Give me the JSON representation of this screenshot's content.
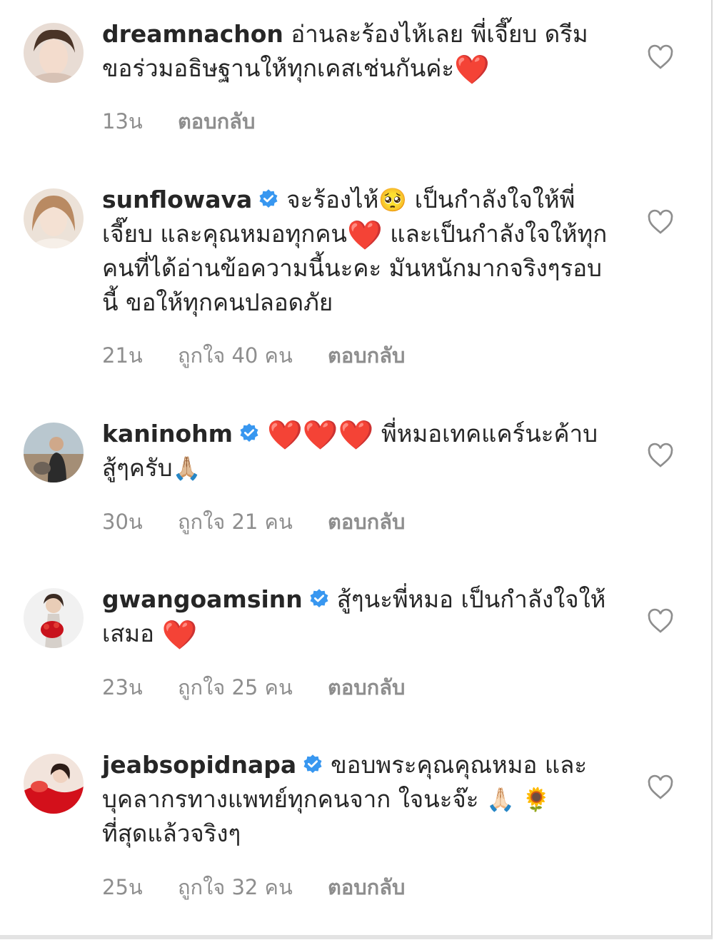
{
  "colors": {
    "text": "#262626",
    "meta": "#8e8e8e",
    "verified": "#3897f0",
    "heart": "#e0101b"
  },
  "icons": {
    "like": "heart-outline-icon",
    "verified": "verified-badge-icon"
  },
  "comments": [
    {
      "username": "dreamnachon",
      "verified": false,
      "text_parts": [
        "อ่านละร้องไห้เลย พี่เจี๊ยบ ดรีมขอร่วมอธิษฐานให้ทุกเคสเช่นกันค่ะ",
        "❤️"
      ],
      "time": "13น",
      "likes": "",
      "reply": "ตอบกลับ"
    },
    {
      "username": "sunflowava",
      "verified": true,
      "text_parts": [
        "จะร้องไห้",
        "🥺",
        " เป็นกำลังใจให้พี่เจี๊ยบ และคุณหมอทุกคน",
        "❤️",
        " และเป็นกำลังใจให้ทุกคนที่ได้อ่านข้อความนี้นะคะ มันหนักมากจริงๆรอบนี้ ขอให้ทุกคนปลอดภัย"
      ],
      "time": "21น",
      "likes": "ถูกใจ 40 คน",
      "reply": "ตอบกลับ"
    },
    {
      "username": "kaninohm",
      "verified": true,
      "text_parts": [
        "❤️❤️❤️",
        " พี่หมอเทคแคร์นะค้าบ สู้ๆครับ",
        "🙏🏼"
      ],
      "time": "30น",
      "likes": "ถูกใจ 21 คน",
      "reply": "ตอบกลับ"
    },
    {
      "username": "gwangoamsinn",
      "verified": true,
      "text_parts": [
        "สู้ๆนะพี่หมอ เป็นกำลังใจให้เสมอ ",
        "❤️"
      ],
      "time": "23น",
      "likes": "ถูกใจ 25 คน",
      "reply": "ตอบกลับ"
    },
    {
      "username": "jeabsopidnapa",
      "verified": true,
      "text_parts": [
        "ขอบพระคุณคุณหมอ และบุคลากรทางแพทย์ทุกคนจาก ใจนะจ๊ะ ",
        "🙏🏻 🌻",
        "ที่สุดแล้วจริงๆ"
      ],
      "time": "25น",
      "likes": "ถูกใจ 32 คน",
      "reply": "ตอบกลับ"
    }
  ]
}
